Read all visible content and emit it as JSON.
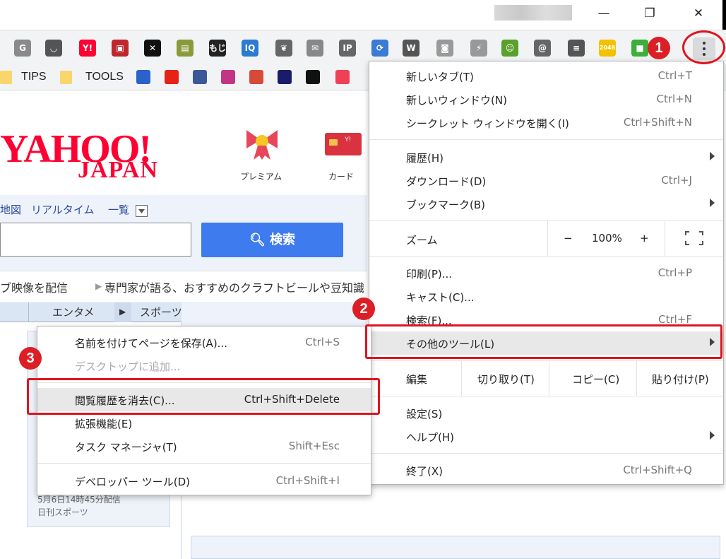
{
  "window": {
    "controls": {
      "minimize": "—",
      "restore": "❐",
      "close": "✕"
    }
  },
  "extensions": [
    {
      "icon": "g-icon",
      "glyph": "G",
      "color": "#8a8a8a"
    },
    {
      "icon": "pocket-icon",
      "glyph": "◡",
      "color": "#555555"
    },
    {
      "icon": "yahoo-icon",
      "glyph": "Y!",
      "color": "#ff0033"
    },
    {
      "icon": "gift-icon",
      "glyph": "▣",
      "color": "#c0262d"
    },
    {
      "icon": "x-icon",
      "glyph": "✕",
      "color": "#111111"
    },
    {
      "icon": "notepad-icon",
      "glyph": "▤",
      "color": "#8a9a3a"
    },
    {
      "icon": "kanji-icon",
      "glyph": "もじ",
      "color": "#222222"
    },
    {
      "icon": "iq-icon",
      "glyph": "IQ",
      "color": "#2b7bd0"
    },
    {
      "icon": "evernote-icon",
      "glyph": "❦",
      "color": "#666666"
    },
    {
      "icon": "mail-icon",
      "glyph": "✉",
      "color": "#888888"
    },
    {
      "icon": "ip-icon",
      "glyph": "IP",
      "color": "#666666"
    },
    {
      "icon": "sync-icon",
      "glyph": "⟳",
      "color": "#3a7bd5"
    },
    {
      "icon": "w-icon",
      "glyph": "W",
      "color": "#555555"
    },
    {
      "icon": "capture-icon",
      "glyph": "◙",
      "color": "#999999"
    },
    {
      "icon": "pdf-icon",
      "glyph": "⚡",
      "color": "#999999"
    },
    {
      "icon": "frog-icon",
      "glyph": "☺",
      "color": "#5aa02c"
    },
    {
      "icon": "atmark-icon",
      "glyph": "@",
      "color": "#666666"
    },
    {
      "icon": "list-icon",
      "glyph": "≡",
      "color": "#555555"
    },
    {
      "icon": "2048-icon",
      "glyph": "2048",
      "color": "#f2c200"
    },
    {
      "icon": "palette-icon",
      "glyph": "■",
      "color": "#3cae3a"
    }
  ],
  "bookmarks": [
    {
      "label": "TIPS"
    },
    {
      "label": "TOOLS"
    }
  ],
  "bookmark_icons": [
    {
      "icon": "calendar-icon",
      "color": "#2a62c9"
    },
    {
      "icon": "youtube-icon",
      "color": "#e62117"
    },
    {
      "icon": "facebook-icon",
      "color": "#3b5998"
    },
    {
      "icon": "instagram-icon",
      "color": "#c13584"
    },
    {
      "icon": "horse-icon",
      "color": "#d84a38"
    },
    {
      "icon": "target-icon",
      "color": "#1b1b6b"
    },
    {
      "icon": "cc-icon",
      "color": "#111111"
    },
    {
      "icon": "pocket-save-icon",
      "color": "#ef4056"
    }
  ],
  "page": {
    "logo_top": "YAHOO!",
    "logo_bottom": "JAPAN",
    "premium": "プレミアム",
    "card": "カード",
    "nav": [
      "地図",
      "リアルタイム",
      "一覧"
    ],
    "search_button": "検索",
    "news_left": "ブ映像を配信",
    "news_right": "専門家が語る、おすすめのクラフトビールや豆知識",
    "tabs": [
      "エンタメ",
      "スポーツ"
    ],
    "card_date": "5月6日14時45分配信",
    "card_source": "日刊スポーツ"
  },
  "menu": {
    "new_tab": {
      "label": "新しいタブ(T)",
      "shortcut": "Ctrl+T"
    },
    "new_window": {
      "label": "新しいウィンドウ(N)",
      "shortcut": "Ctrl+N"
    },
    "incognito": {
      "label": "シークレット ウィンドウを開く(I)",
      "shortcut": "Ctrl+Shift+N"
    },
    "history": {
      "label": "履歴(H)"
    },
    "downloads": {
      "label": "ダウンロード(D)",
      "shortcut": "Ctrl+J"
    },
    "bookmarks": {
      "label": "ブックマーク(B)"
    },
    "zoom": {
      "label": "ズーム",
      "minus": "−",
      "value": "100%",
      "plus": "+"
    },
    "print": {
      "label": "印刷(P)...",
      "shortcut": "Ctrl+P"
    },
    "cast": {
      "label": "キャスト(C)..."
    },
    "find": {
      "label": "検索(F)...",
      "shortcut": "Ctrl+F"
    },
    "more_tools": {
      "label": "その他のツール(L)"
    },
    "edit": {
      "label": "編集",
      "cut": "切り取り(T)",
      "copy": "コピー(C)",
      "paste": "貼り付け(P)"
    },
    "settings": {
      "label": "設定(S)"
    },
    "help": {
      "label": "ヘルプ(H)"
    },
    "exit": {
      "label": "終了(X)",
      "shortcut": "Ctrl+Shift+Q"
    }
  },
  "submenu": {
    "save_page": {
      "label": "名前を付けてページを保存(A)...",
      "shortcut": "Ctrl+S"
    },
    "add_desktop": {
      "label": "デスクトップに追加..."
    },
    "clear_history": {
      "label": "閲覧履歴を消去(C)...",
      "shortcut": "Ctrl+Shift+Delete"
    },
    "extensions": {
      "label": "拡張機能(E)"
    },
    "task_manager": {
      "label": "タスク マネージャ(T)",
      "shortcut": "Shift+Esc"
    },
    "dev_tools": {
      "label": "デベロッパー ツール(D)",
      "shortcut": "Ctrl+Shift+I"
    }
  },
  "annotations": {
    "step1": "1",
    "step2": "2",
    "step3": "3",
    "highlight_color": "#e0141e"
  }
}
